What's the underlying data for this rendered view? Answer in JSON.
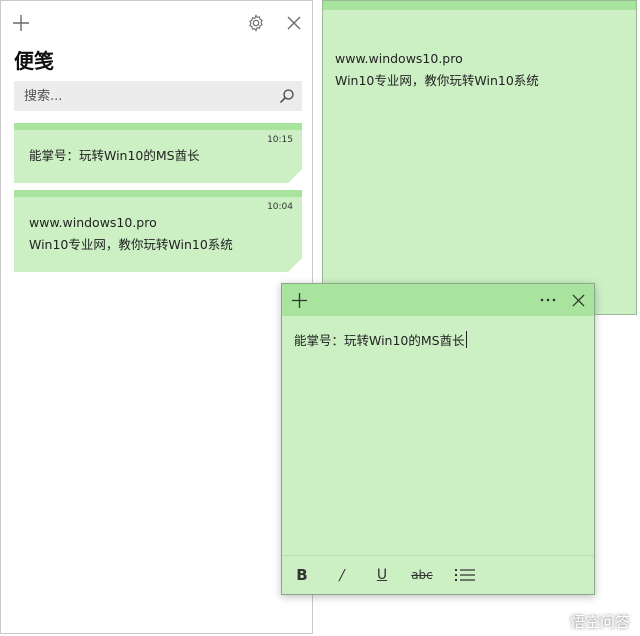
{
  "panel": {
    "title": "便笺",
    "search_placeholder": "搜索..."
  },
  "cards": [
    {
      "time": "10:15",
      "line1": "能掌号：玩转Win10的MS酋长"
    },
    {
      "time": "10:04",
      "line1": "www.windows10.pro",
      "line2": "Win10专业网，教你玩转Win10系统"
    }
  ],
  "note_back": {
    "line1": "www.windows10.pro",
    "line2": "Win10专业网，教你玩转Win10系统"
  },
  "note_front": {
    "content": "能掌号：玩转Win10的MS酋长",
    "toolbar": {
      "bold": "B",
      "italic": "/",
      "underline": "U",
      "strike": "abc"
    }
  },
  "watermark": {
    "text": "悟空问答"
  },
  "colors": {
    "note_body": "#ccf0c4",
    "note_header": "#a9e49e",
    "search_bg": "#ececec"
  }
}
